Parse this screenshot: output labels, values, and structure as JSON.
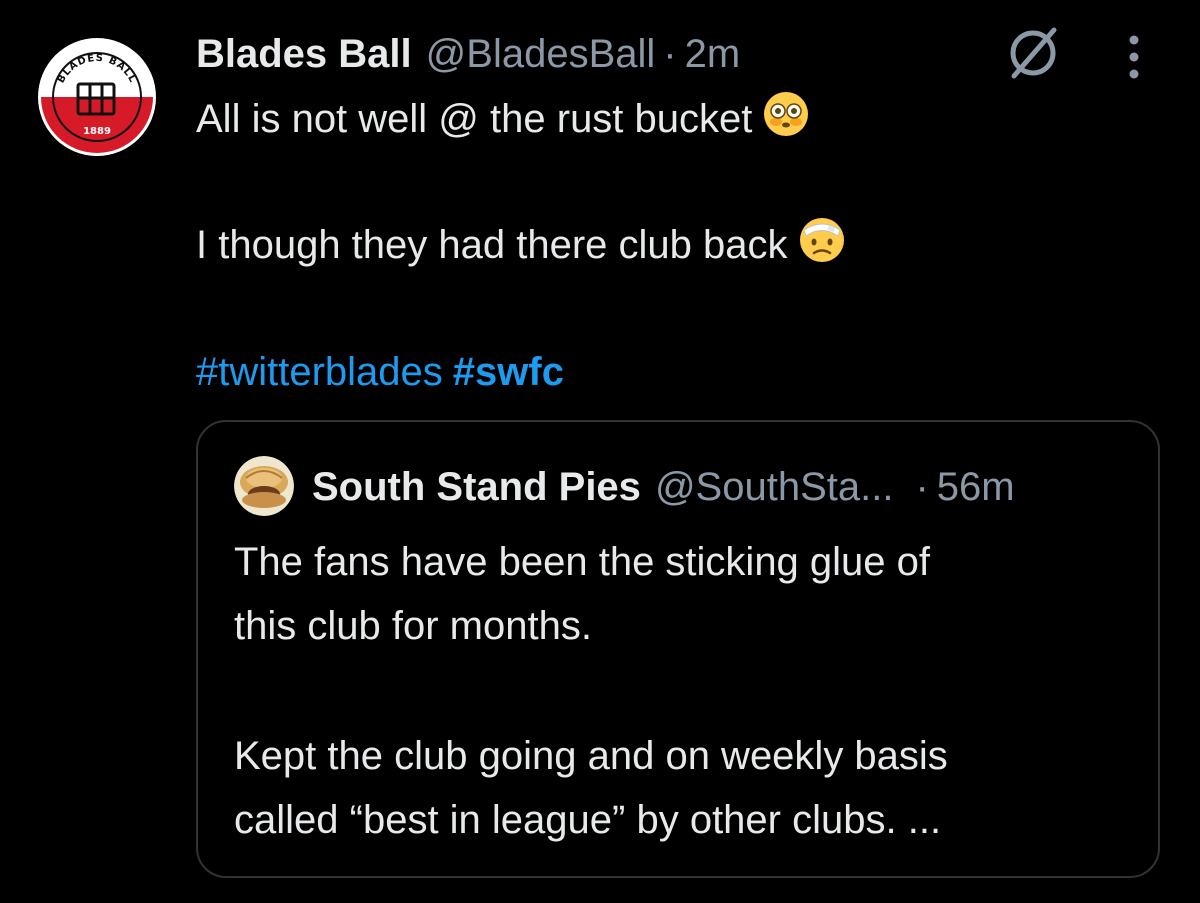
{
  "tweet": {
    "author_name": "Blades Ball",
    "author_handle": "@BladesBall",
    "separator": "·",
    "time": "2m",
    "avatar_text_top": "BLADES BALL",
    "avatar_text_bottom": "1889",
    "line1": "All is not well @ the rust bucket",
    "line1_emoji": "flushed-face-emoji",
    "line2": "I though they had there club back",
    "line2_emoji": "face-with-head-bandage-emoji",
    "hashtag1": "#twitterblades",
    "hashtag2": "#swfc"
  },
  "quote": {
    "author_name": "South Stand Pies",
    "author_handle": "@SouthSta...",
    "separator": "·",
    "time": "56m",
    "line1": "The fans have been the sticking glue of",
    "line2": "this club for months.",
    "line3": "Kept the club going and on weekly basis",
    "line4": "called “best in league” by other clubs. ..."
  },
  "icons": {
    "grok": "grok-icon",
    "more": "more-vertical-icon"
  },
  "colors": {
    "background": "#000000",
    "text": "#e7e9ea",
    "secondary": "#8b98a5",
    "link": "#1d9bf0",
    "border": "#2f3336",
    "club_red": "#d71a28"
  }
}
